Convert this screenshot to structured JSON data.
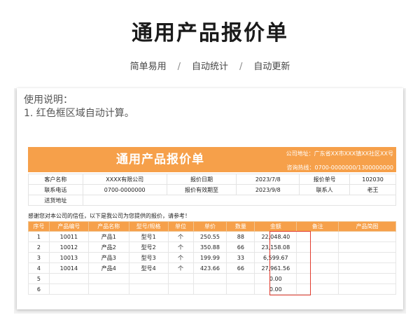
{
  "hero": {
    "title": "通用产品报价单",
    "features": [
      "简单易用",
      "自动统计",
      "自动更新"
    ],
    "separator": "/"
  },
  "usage": {
    "title": "使用说明：",
    "lines": [
      "1. 红色框区域自动计算。"
    ]
  },
  "quote": {
    "title": "通用产品报价单",
    "company_address": "公司地址：广东省XX市XXX镇XX社区XX号",
    "hotline": "咨询热线：0700-0000000/1300000000",
    "info": {
      "customer_label": "客户名称",
      "customer_value": "XXXX有限公司",
      "date_label": "报价日期",
      "date_value": "2023/7/8",
      "number_label": "报价单号",
      "number_value": "102030",
      "phone_label": "联系电话",
      "phone_value": "0700-0000000",
      "valid_label": "报价有效期至",
      "valid_value": "2023/9/8",
      "contact_label": "联系人",
      "contact_value": "老王",
      "address_label": "送货地址",
      "address_value": ""
    },
    "thanks": "感谢您对本公司的信任，以下是我公司为您提供的报价，请参考！",
    "columns": [
      "序号",
      "产品编号",
      "产品名称",
      "型号/规格",
      "单位",
      "单价",
      "数量",
      "金额",
      "备注",
      "产品简图"
    ],
    "rows": [
      [
        "1",
        "10011",
        "产品1",
        "型号1",
        "个",
        "250.55",
        "88",
        "22,048.40",
        "",
        ""
      ],
      [
        "2",
        "10012",
        "产品2",
        "型号2",
        "个",
        "350.88",
        "66",
        "23,158.08",
        "",
        ""
      ],
      [
        "3",
        "10013",
        "产品3",
        "型号3",
        "个",
        "199.99",
        "33",
        "6,599.67",
        "",
        ""
      ],
      [
        "4",
        "10014",
        "产品4",
        "型号4",
        "个",
        "423.66",
        "66",
        "27,961.56",
        "",
        ""
      ],
      [
        "5",
        "",
        "",
        "",
        "",
        "",
        "",
        "0.00",
        "",
        ""
      ],
      [
        "6",
        "",
        "",
        "",
        "",
        "",
        "",
        "0.00",
        "",
        ""
      ]
    ]
  },
  "colors": {
    "accent": "#f6a04a",
    "frame": "#e23b2e"
  }
}
